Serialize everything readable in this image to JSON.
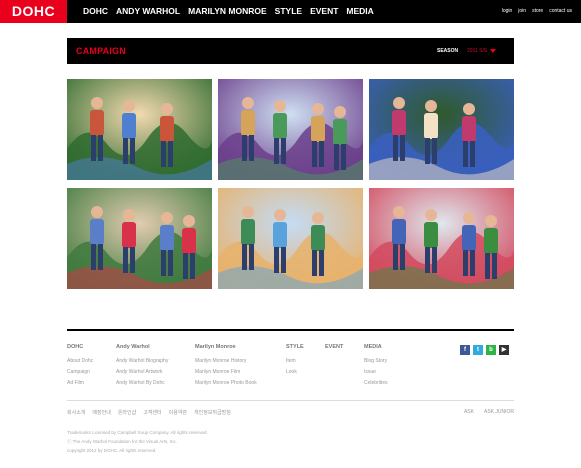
{
  "brand": {
    "logo": "DOHC"
  },
  "nav": {
    "items": [
      "DOHC",
      "ANDY WARHOL",
      "MARILYN MONROE",
      "STYLE",
      "EVENT",
      "MEDIA"
    ],
    "util": [
      "login",
      "join",
      "store",
      "contact us"
    ]
  },
  "campaign": {
    "title": "CAMPAIGN",
    "season_label": "SEASON",
    "season_value": "2011 S/S"
  },
  "gallery": {
    "photos": [
      {
        "name": "campaign-photo-1",
        "colors": [
          "#f3d9b0",
          "#4f7fd0",
          "#2f6b2f",
          "#c9553a"
        ]
      },
      {
        "name": "campaign-photo-2",
        "colors": [
          "#cfe0f2",
          "#4a9b5a",
          "#6b3f8b",
          "#d6a35a"
        ]
      },
      {
        "name": "campaign-photo-3",
        "colors": [
          "#2f5a2a",
          "#f2e1c5",
          "#3a5fbf",
          "#c03a6e"
        ]
      },
      {
        "name": "campaign-photo-4",
        "colors": [
          "#e2ccb0",
          "#d9314a",
          "#3f7a3f",
          "#5b7ec9"
        ]
      },
      {
        "name": "campaign-photo-5",
        "colors": [
          "#c4dcf5",
          "#5aa2dc",
          "#e7b16b",
          "#3d8b56"
        ]
      },
      {
        "name": "campaign-photo-6",
        "colors": [
          "#dfe8ee",
          "#3b8d3f",
          "#d24a5e",
          "#4464b8"
        ]
      }
    ]
  },
  "footer": {
    "columns": [
      {
        "head": "DOHC",
        "links": [
          "About Dohc",
          "Campaign",
          "Ad Film"
        ]
      },
      {
        "head": "Andy Warhol",
        "links": [
          "Andy Warhol Biography",
          "Andy Warhol Artwork",
          "Andy Warhol By Dohc"
        ]
      },
      {
        "head": "Marilyn Monroe",
        "links": [
          "Marilyn Monroe History",
          "Marilyn Monroe Film",
          "Marilyn Monroe Photo Book"
        ]
      },
      {
        "head": "STYLE",
        "links": [
          "Item",
          "Look"
        ]
      },
      {
        "head": "EVENT",
        "links": []
      },
      {
        "head": "MEDIA",
        "links": [
          "Blog Story",
          "Issue",
          "Celebrities"
        ]
      }
    ],
    "social": [
      {
        "name": "facebook-icon",
        "glyph": "f",
        "color": "#3b5998"
      },
      {
        "name": "twitter-icon",
        "glyph": "t",
        "color": "#33aadd"
      },
      {
        "name": "blog-icon",
        "glyph": "b",
        "color": "#2fb44a"
      },
      {
        "name": "youtube-icon",
        "glyph": "▶",
        "color": "#333333"
      }
    ],
    "policy": [
      "회사소개",
      "매장안내",
      "온라인샵",
      "고객센터",
      "이용약관",
      "개인정보취급방침"
    ],
    "family": [
      "ASK",
      "ASK JUNIOR"
    ],
    "copyright": [
      "Trademarks Licensed by Campbell Soup Company. All rights reserved.",
      "ⓒ The Andy Warhol Foundation for the Visual Arts, Inc.",
      "copyright 2012 by DOHC. All rights reserved."
    ]
  }
}
